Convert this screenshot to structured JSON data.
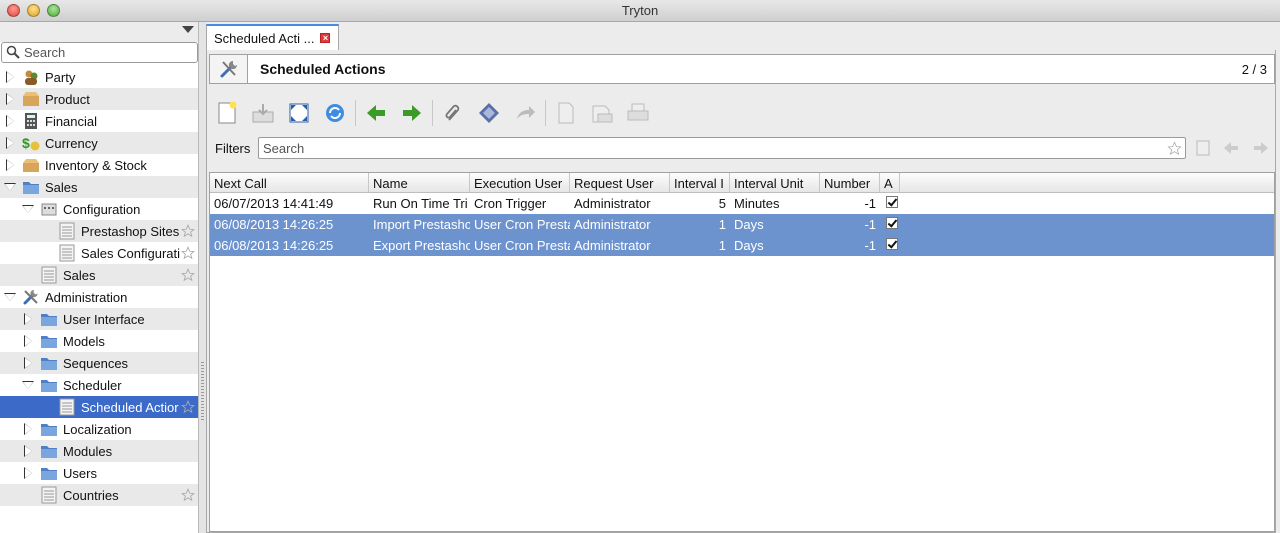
{
  "window": {
    "title": "Tryton"
  },
  "sidebar": {
    "search_placeholder": "Search",
    "items": [
      {
        "label": "Party",
        "indent": 0,
        "expander": "closed",
        "icon": "party-icon",
        "star": false
      },
      {
        "label": "Product",
        "indent": 0,
        "expander": "closed",
        "icon": "product-box-icon",
        "star": false
      },
      {
        "label": "Financial",
        "indent": 0,
        "expander": "closed",
        "icon": "calculator-icon",
        "star": false
      },
      {
        "label": "Currency",
        "indent": 0,
        "expander": "closed",
        "icon": "currency-icon",
        "star": false
      },
      {
        "label": "Inventory & Stock",
        "indent": 0,
        "expander": "closed",
        "icon": "stock-box-icon",
        "star": false
      },
      {
        "label": "Sales",
        "indent": 0,
        "expander": "open",
        "icon": "folder-icon",
        "star": false
      },
      {
        "label": "Configuration",
        "indent": 1,
        "expander": "open",
        "icon": "configuration-icon",
        "star": false
      },
      {
        "label": "Prestashop Sites",
        "indent": 2,
        "expander": "none",
        "icon": "list-icon",
        "star": true
      },
      {
        "label": "Sales Configurati",
        "indent": 2,
        "expander": "none",
        "icon": "list-icon",
        "star": true
      },
      {
        "label": "Sales",
        "indent": 1,
        "expander": "none",
        "icon": "list-icon",
        "star": true
      },
      {
        "label": "Administration",
        "indent": 0,
        "expander": "open",
        "icon": "tools-icon",
        "star": false
      },
      {
        "label": "User Interface",
        "indent": 1,
        "expander": "closed",
        "icon": "folder-icon",
        "star": false
      },
      {
        "label": "Models",
        "indent": 1,
        "expander": "closed",
        "icon": "folder-icon",
        "star": false
      },
      {
        "label": "Sequences",
        "indent": 1,
        "expander": "closed",
        "icon": "folder-icon",
        "star": false
      },
      {
        "label": "Scheduler",
        "indent": 1,
        "expander": "open",
        "icon": "folder-icon",
        "star": false
      },
      {
        "label": "Scheduled Actior",
        "indent": 2,
        "expander": "none",
        "icon": "list-icon",
        "star": true,
        "selected": true
      },
      {
        "label": "Localization",
        "indent": 1,
        "expander": "closed",
        "icon": "folder-icon",
        "star": false
      },
      {
        "label": "Modules",
        "indent": 1,
        "expander": "closed",
        "icon": "folder-icon",
        "star": false
      },
      {
        "label": "Users",
        "indent": 1,
        "expander": "closed",
        "icon": "folder-icon",
        "star": false
      },
      {
        "label": "Countries",
        "indent": 1,
        "expander": "none",
        "icon": "list-icon",
        "star": true
      }
    ]
  },
  "tab": {
    "label": "Scheduled Acti ...",
    "close_symbol": "×"
  },
  "header": {
    "title": "Scheduled Actions",
    "record_count": "2 / 3"
  },
  "toolbar": {
    "buttons": [
      {
        "name": "new-record-button",
        "icon": "new-document-icon"
      },
      {
        "name": "save-button",
        "icon": "save-icon"
      },
      {
        "name": "switch-view-button",
        "icon": "fullscreen-icon"
      },
      {
        "name": "reload-button",
        "icon": "refresh-icon"
      },
      {
        "name": "previous-record-button",
        "icon": "arrow-left-icon"
      },
      {
        "name": "next-record-button",
        "icon": "arrow-right-icon"
      },
      {
        "name": "attachment-button",
        "icon": "paperclip-icon"
      },
      {
        "name": "action-button",
        "icon": "gear-diamond-icon"
      },
      {
        "name": "relate-button",
        "icon": "forward-arrow-icon"
      },
      {
        "name": "report-button",
        "icon": "report-icon"
      },
      {
        "name": "email-button",
        "icon": "email-icon"
      },
      {
        "name": "print-button",
        "icon": "print-icon"
      }
    ]
  },
  "filters": {
    "label": "Filters",
    "placeholder": "Search"
  },
  "table": {
    "columns": [
      "Next Call",
      "Name",
      "Execution User",
      "Request User",
      "Interval I",
      "Interval Unit",
      "Number",
      "A"
    ],
    "rows": [
      {
        "next_call": "06/07/2013 14:41:49",
        "name": "Run On Time Tri",
        "execution_user": "Cron Trigger",
        "request_user": "Administrator",
        "interval": "5",
        "unit": "Minutes",
        "number": "-1",
        "active": true,
        "selected": false
      },
      {
        "next_call": "06/08/2013 14:26:25",
        "name": "Import Prestashc",
        "execution_user": "User Cron Presta",
        "request_user": "Administrator",
        "interval": "1",
        "unit": "Days",
        "number": "-1",
        "active": true,
        "selected": true
      },
      {
        "next_call": "06/08/2013 14:26:25",
        "name": "Export Prestashc",
        "execution_user": "User Cron Presta",
        "request_user": "Administrator",
        "interval": "1",
        "unit": "Days",
        "number": "-1",
        "active": true,
        "selected": true
      }
    ]
  },
  "colors": {
    "selection": "#3b6ac9",
    "row_selection": "#6d93cf",
    "tab_accent": "#4a8be0"
  }
}
